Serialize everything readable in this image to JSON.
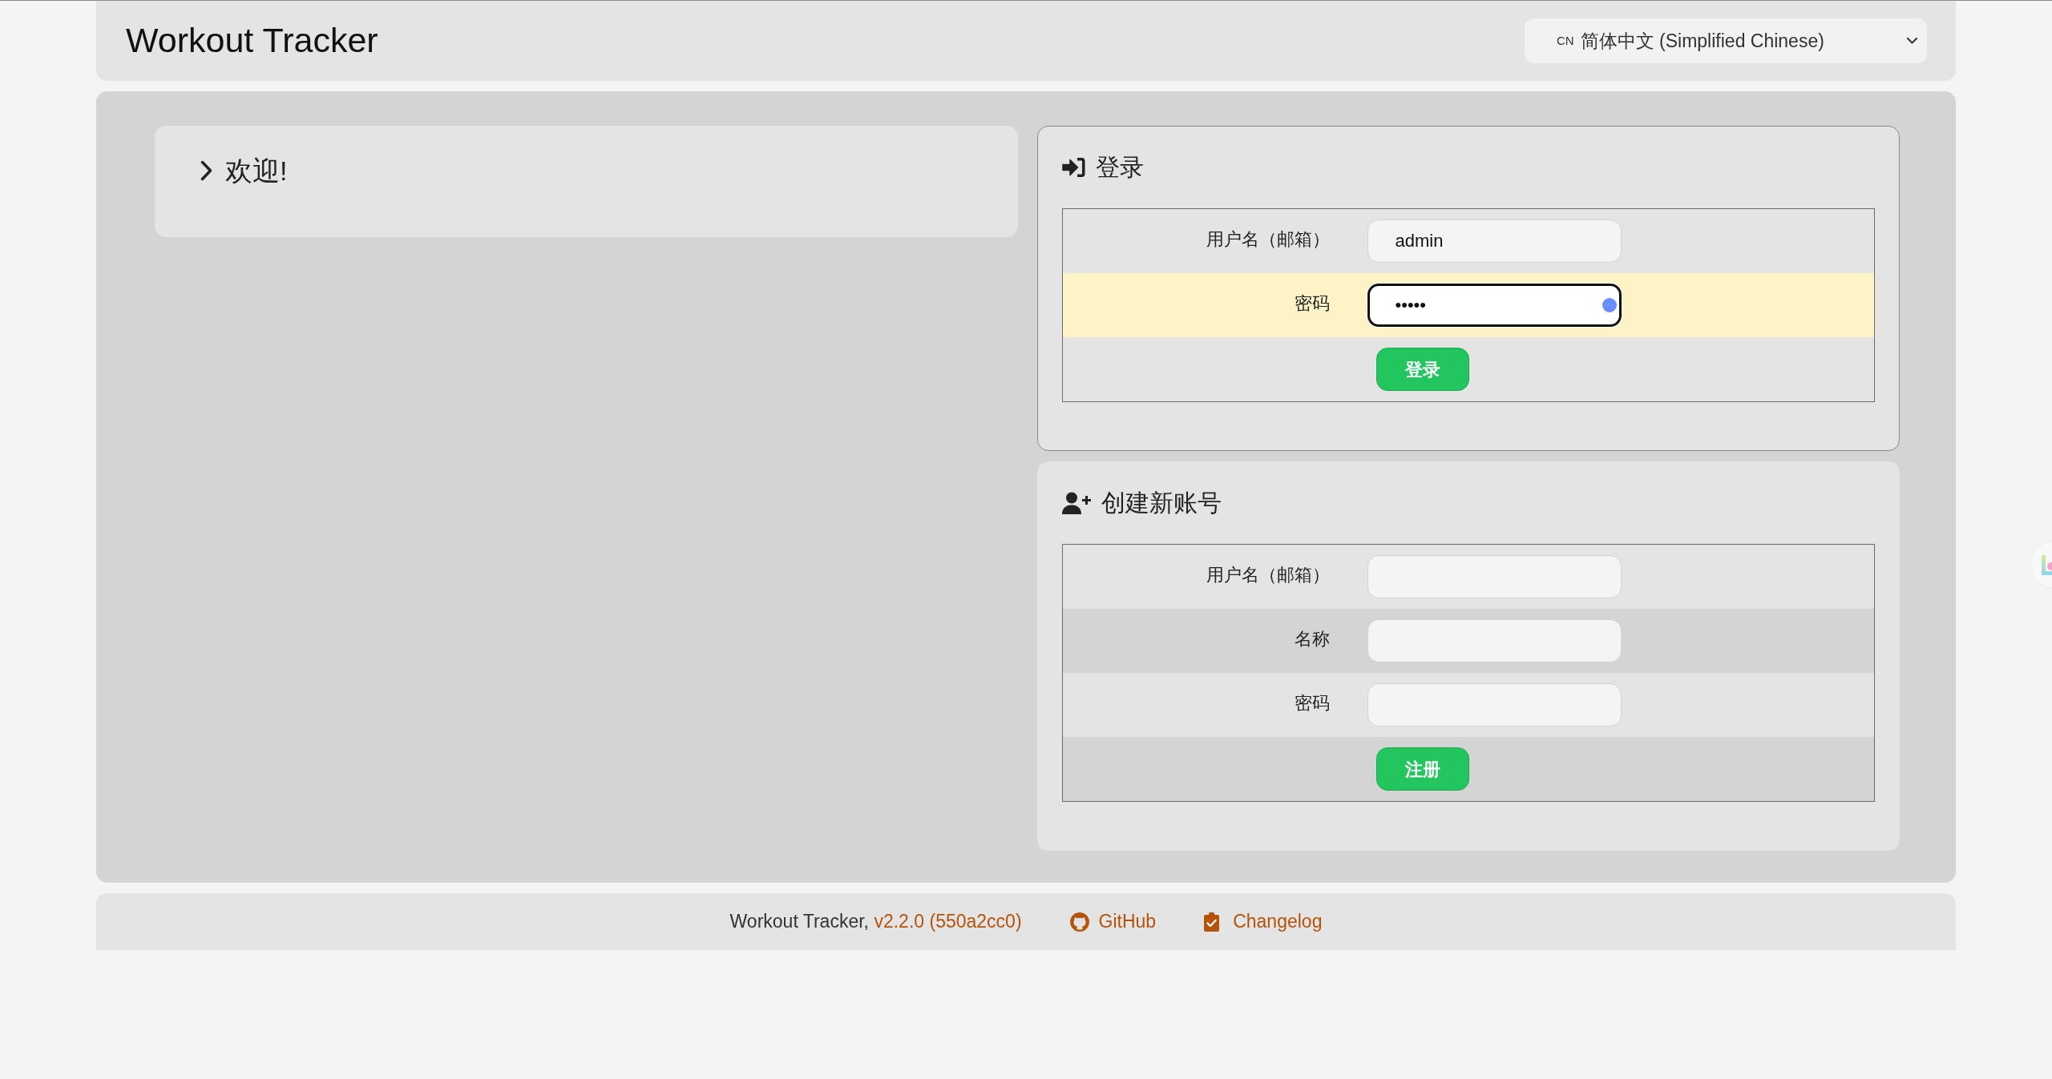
{
  "header": {
    "title": "Workout Tracker",
    "language_select": {
      "flag": "CN",
      "value": "简体中文 (Simplified Chinese)"
    }
  },
  "welcome": {
    "title": "欢迎!",
    "expanded": false
  },
  "login": {
    "title": "登录",
    "fields": [
      {
        "label": "用户名（邮箱）",
        "value": "admin",
        "focused": false,
        "highlighted": false
      },
      {
        "label": "密码",
        "value": "•••••",
        "focused": true,
        "highlighted": true
      }
    ],
    "button": "登录"
  },
  "register": {
    "title": "创建新账号",
    "fields": [
      {
        "label": "用户名（邮箱）",
        "focused": false,
        "highlighted": false
      },
      {
        "label": "名称",
        "focused": false,
        "highlighted": false
      },
      {
        "label": "密码",
        "focused": false,
        "highlighted": false
      }
    ],
    "button": "注册"
  },
  "footer": {
    "app_name": "Workout Tracker,",
    "version": "v2.2.0 (550a2cc0)",
    "links": [
      "GitHub",
      "Changelog"
    ]
  }
}
